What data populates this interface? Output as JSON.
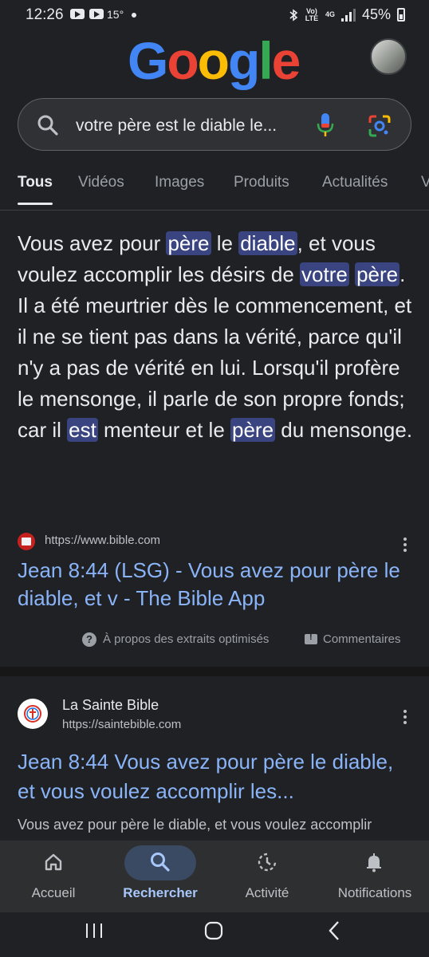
{
  "status_bar": {
    "time": "12:26",
    "temperature": "15°",
    "network_label": "Vo) LTE",
    "signal_type": "4G",
    "battery": "45%"
  },
  "logo": {
    "text": "Google",
    "letter_colors": [
      "#4285f4",
      "#ea4335",
      "#fbbc05",
      "#4285f4",
      "#34a853",
      "#ea4335"
    ]
  },
  "search": {
    "query": "votre père est le diable le...",
    "icons": [
      "search-icon",
      "mic-icon",
      "lens-icon"
    ]
  },
  "tabs": [
    {
      "label": "Tous",
      "active": true
    },
    {
      "label": "Vidéos"
    },
    {
      "label": "Images"
    },
    {
      "label": "Produits"
    },
    {
      "label": "Actualités"
    },
    {
      "label": "V"
    }
  ],
  "snippet": {
    "segments": [
      {
        "text": "Vous avez pour "
      },
      {
        "text": "père",
        "hl": true
      },
      {
        "text": " le "
      },
      {
        "text": "diable",
        "hl": true
      },
      {
        "text": ", et vous voulez accomplir les désirs de "
      },
      {
        "text": "votre",
        "hl": true
      },
      {
        "text": " "
      },
      {
        "text": "père",
        "hl": true
      },
      {
        "text": ". Il a été meurtrier dès le commencement, et il ne se tient pas dans la vérité, parce qu'il n'y a pas de vérité en lui. Lorsqu'il profère le mensonge, il parle de son propre fonds; car il "
      },
      {
        "text": "est",
        "hl": true
      },
      {
        "text": " menteur et le "
      },
      {
        "text": "père",
        "hl": true
      },
      {
        "text": " du mensonge."
      }
    ],
    "highlight_color": "#394480",
    "source_url": "https://www.bible.com",
    "link_title": "Jean 8:44 (LSG) - Vous avez pour père le diable, et v - The Bible App",
    "about_label": "À propos des extraits optimisés",
    "feedback_label": "Commentaires"
  },
  "result2": {
    "site_name": "La Sainte Bible",
    "url": "https://saintebible.com",
    "title": "Jean 8:44 Vous avez pour père le diable, et vous voulez accomplir les...",
    "description": "Vous avez pour père le diable, et vous voulez accomplir"
  },
  "bottom_nav": [
    {
      "label": "Accueil",
      "icon": "home-icon"
    },
    {
      "label": "Rechercher",
      "icon": "search-icon",
      "active": true
    },
    {
      "label": "Activité",
      "icon": "activity-icon"
    },
    {
      "label": "Notifications",
      "icon": "bell-icon"
    }
  ],
  "accent_color": "#8ab4f8"
}
